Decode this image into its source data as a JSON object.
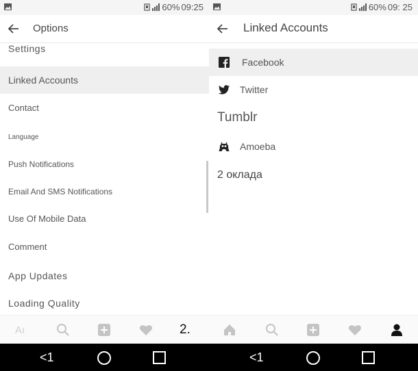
{
  "colors": {
    "active_row": "#efefef",
    "nav_icon": "#c4c4c4",
    "nav_active": "#111111",
    "system_bar": "#000000"
  },
  "left": {
    "status": {
      "battery": "60%",
      "time": "09:25"
    },
    "title": "Options",
    "menu": [
      {
        "label": "Settings"
      },
      {
        "label": "Linked Accounts"
      },
      {
        "label": "Contact"
      },
      {
        "label": "Language"
      },
      {
        "label": "Push Notifications"
      },
      {
        "label": "Email And SMS Notifications"
      },
      {
        "label": "Use Of Mobile Data"
      },
      {
        "label": "Comment"
      },
      {
        "label": "App Updates"
      },
      {
        "label": "Loading Quality"
      }
    ],
    "nav": {
      "home_label": "Aı",
      "profile_label": "2."
    }
  },
  "right": {
    "status": {
      "battery": "60%",
      "time": "09: 25"
    },
    "title": "Linked Accounts",
    "accounts": [
      {
        "label": "Facebook",
        "icon": "facebook-icon"
      },
      {
        "label": "Twitter",
        "icon": "twitter-icon"
      },
      {
        "label": "Tumblr",
        "icon": "tumblr-icon"
      },
      {
        "label": "Amoeba",
        "icon": "amoeba-icon"
      },
      {
        "label": "2 оклада"
      }
    ]
  },
  "system": {
    "back_label": "<1"
  }
}
